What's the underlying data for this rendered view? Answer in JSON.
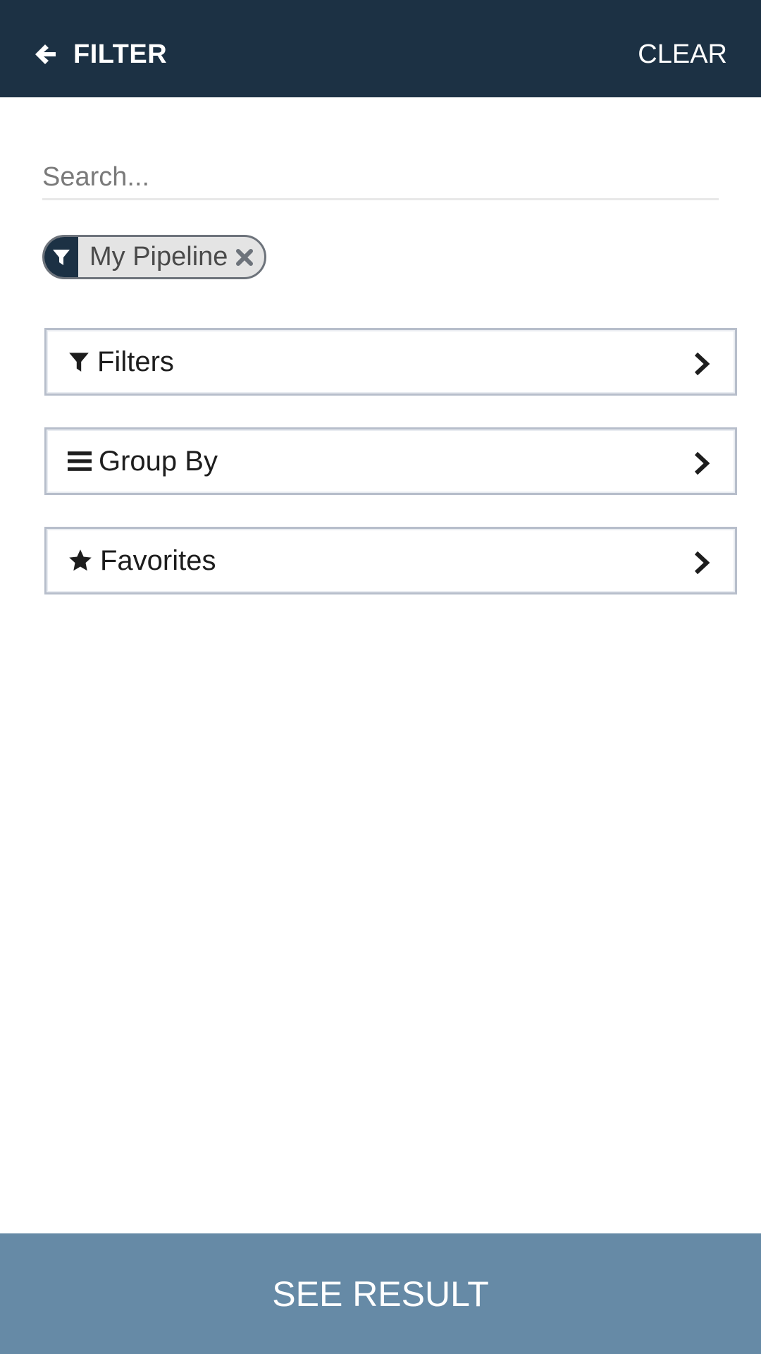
{
  "header": {
    "title": "FILTER",
    "clear_label": "CLEAR",
    "back_icon": "arrow-left-icon",
    "background": "#1c3144"
  },
  "search": {
    "value": "",
    "placeholder": "Search..."
  },
  "facet": {
    "label": "My Pipeline",
    "icon": "filter-icon",
    "remove_icon": "close-icon"
  },
  "options": [
    {
      "label": "Filters",
      "icon": "filter-icon"
    },
    {
      "label": "Group By",
      "icon": "bars-icon"
    },
    {
      "label": "Favorites",
      "icon": "star-icon"
    }
  ],
  "footer": {
    "label": "SEE RESULT",
    "background": "#668aa6"
  }
}
